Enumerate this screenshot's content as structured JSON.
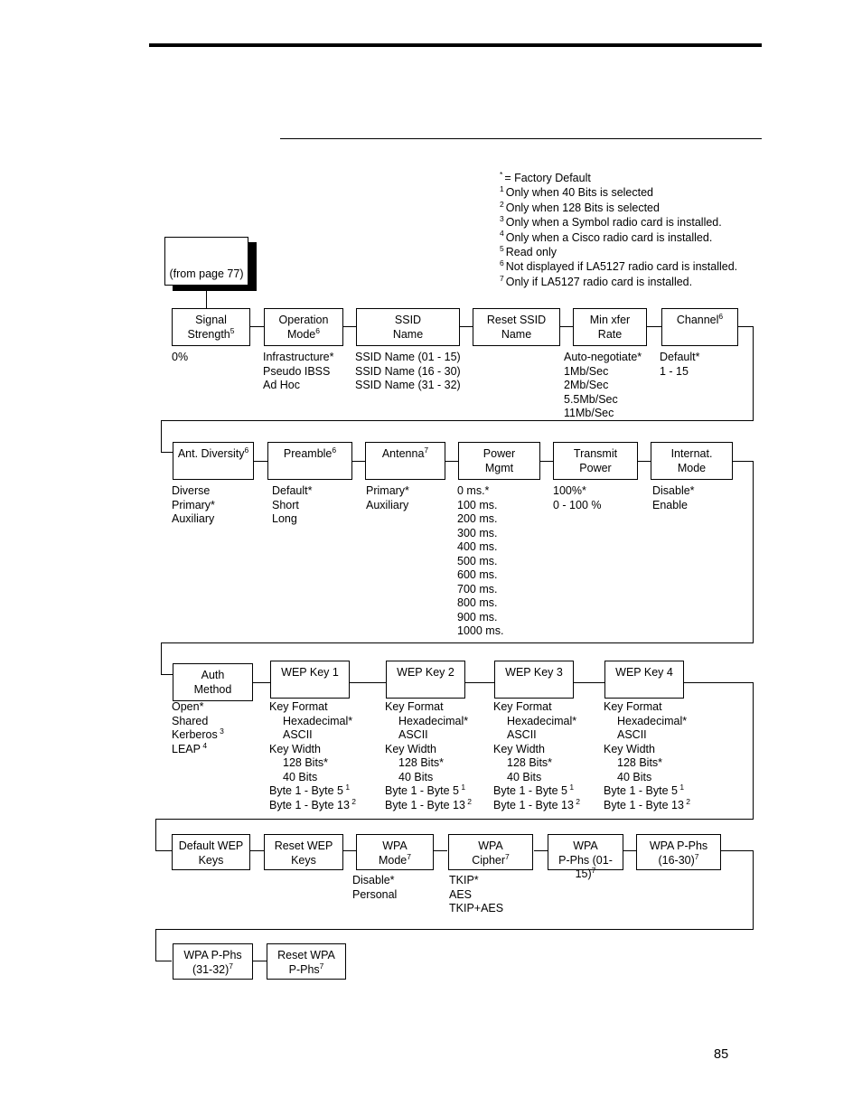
{
  "page": {
    "number": "85"
  },
  "legend": {
    "lines": [
      {
        "marker": "*",
        "text": "= Factory Default"
      },
      {
        "marker": "1",
        "text": "Only when 40 Bits is selected"
      },
      {
        "marker": "2",
        "text": "Only when 128 Bits is selected"
      },
      {
        "marker": "3",
        "text": "Only when a Symbol radio card is installed."
      },
      {
        "marker": "4",
        "text": "Only when a Cisco radio card is installed."
      },
      {
        "marker": "5",
        "text": "Read only"
      },
      {
        "marker": "6",
        "text": "Not displayed if LA5127 radio card is installed."
      },
      {
        "marker": "7",
        "text": "Only if LA5127 radio card is installed."
      }
    ]
  },
  "from_page_box": {
    "label": "(from page 77)"
  },
  "boxes": {
    "signal_strength": {
      "line1": "Signal",
      "line2": "Strength",
      "sup": "5"
    },
    "operation_mode": {
      "line1": "Operation",
      "line2": "Mode",
      "sup": "6"
    },
    "ssid_name": {
      "line1": "SSID",
      "line2": "Name",
      "sup": ""
    },
    "reset_ssid_name": {
      "line1": "Reset SSID",
      "line2": "Name",
      "sup": ""
    },
    "min_xfer_rate": {
      "line1": "Min xfer",
      "line2": "Rate",
      "sup": ""
    },
    "channel": {
      "line1": "Channel",
      "line2": "",
      "sup": "6"
    },
    "ant_diversity": {
      "line1": "Ant. Diversity",
      "line2": "",
      "sup": "6"
    },
    "preamble": {
      "line1": "Preamble",
      "line2": "",
      "sup": "6"
    },
    "antenna": {
      "line1": "Antenna",
      "line2": "",
      "sup": "7"
    },
    "power_mgmt": {
      "line1": "Power",
      "line2": "Mgmt",
      "sup": ""
    },
    "transmit_power": {
      "line1": "Transmit",
      "line2": "Power",
      "sup": ""
    },
    "internat_mode": {
      "line1": "Internat.",
      "line2": "Mode",
      "sup": ""
    },
    "auth_method": {
      "line1": "Auth",
      "line2": "Method",
      "sup": ""
    },
    "wep_key_1": {
      "line1": "WEP Key 1",
      "line2": "",
      "sup": ""
    },
    "wep_key_2": {
      "line1": "WEP Key 2",
      "line2": "",
      "sup": ""
    },
    "wep_key_3": {
      "line1": "WEP Key 3",
      "line2": "",
      "sup": ""
    },
    "wep_key_4": {
      "line1": "WEP Key 4",
      "line2": "",
      "sup": ""
    },
    "default_wep_keys": {
      "line1": "Default WEP",
      "line2": "Keys",
      "sup": ""
    },
    "reset_wep_keys": {
      "line1": "Reset WEP",
      "line2": "Keys",
      "sup": ""
    },
    "wpa_mode": {
      "line1": "WPA",
      "line2": "Mode",
      "sup": "7"
    },
    "wpa_cipher": {
      "line1": "WPA",
      "line2": "Cipher",
      "sup": "7"
    },
    "wpa_pphs_01_15": {
      "line1": "WPA",
      "line2": "P-Phs (01-15)",
      "sup": "7"
    },
    "wpa_pphs_16_30": {
      "line1": "WPA P-Phs",
      "line2": "(16-30)",
      "sup": "7"
    },
    "wpa_pphs_31_32": {
      "line1": "WPA P-Phs",
      "line2": "(31-32)",
      "sup": "7"
    },
    "reset_wpa_pphs": {
      "line1": "Reset WPA",
      "line2": "P-Phs",
      "sup": "7"
    }
  },
  "options": {
    "signal_strength": [
      {
        "text": "0%",
        "indent": false,
        "sup": ""
      }
    ],
    "operation_mode": [
      {
        "text": "Infrastructure*",
        "indent": false,
        "sup": ""
      },
      {
        "text": "Pseudo IBSS",
        "indent": false,
        "sup": ""
      },
      {
        "text": "Ad Hoc",
        "indent": false,
        "sup": ""
      }
    ],
    "ssid_name": [
      {
        "text": "SSID Name (01 - 15)",
        "indent": false,
        "sup": ""
      },
      {
        "text": "SSID Name (16 - 30)",
        "indent": false,
        "sup": ""
      },
      {
        "text": "SSID Name (31 - 32)",
        "indent": false,
        "sup": ""
      }
    ],
    "min_xfer_rate": [
      {
        "text": "Auto-negotiate*",
        "indent": false,
        "sup": ""
      },
      {
        "text": "1Mb/Sec",
        "indent": false,
        "sup": ""
      },
      {
        "text": "2Mb/Sec",
        "indent": false,
        "sup": ""
      },
      {
        "text": "5.5Mb/Sec",
        "indent": false,
        "sup": ""
      },
      {
        "text": "11Mb/Sec",
        "indent": false,
        "sup": ""
      }
    ],
    "channel": [
      {
        "text": "Default*",
        "indent": false,
        "sup": ""
      },
      {
        "text": "1 - 15",
        "indent": false,
        "sup": ""
      }
    ],
    "ant_diversity": [
      {
        "text": "Diverse",
        "indent": false,
        "sup": ""
      },
      {
        "text": "Primary*",
        "indent": false,
        "sup": ""
      },
      {
        "text": "Auxiliary",
        "indent": false,
        "sup": ""
      }
    ],
    "preamble": [
      {
        "text": "Default*",
        "indent": false,
        "sup": ""
      },
      {
        "text": "Short",
        "indent": false,
        "sup": ""
      },
      {
        "text": "Long",
        "indent": false,
        "sup": ""
      }
    ],
    "antenna": [
      {
        "text": "Primary*",
        "indent": false,
        "sup": ""
      },
      {
        "text": "Auxiliary",
        "indent": false,
        "sup": ""
      }
    ],
    "power_mgmt": [
      {
        "text": "0 ms.*",
        "indent": false,
        "sup": ""
      },
      {
        "text": "100 ms.",
        "indent": false,
        "sup": ""
      },
      {
        "text": "200 ms.",
        "indent": false,
        "sup": ""
      },
      {
        "text": "300 ms.",
        "indent": false,
        "sup": ""
      },
      {
        "text": "400 ms.",
        "indent": false,
        "sup": ""
      },
      {
        "text": "500 ms.",
        "indent": false,
        "sup": ""
      },
      {
        "text": "600 ms.",
        "indent": false,
        "sup": ""
      },
      {
        "text": "700 ms.",
        "indent": false,
        "sup": ""
      },
      {
        "text": "800 ms.",
        "indent": false,
        "sup": ""
      },
      {
        "text": "900 ms.",
        "indent": false,
        "sup": ""
      },
      {
        "text": "1000 ms.",
        "indent": false,
        "sup": ""
      }
    ],
    "transmit_power": [
      {
        "text": "100%*",
        "indent": false,
        "sup": ""
      },
      {
        "text": "0 - 100 %",
        "indent": false,
        "sup": ""
      }
    ],
    "internat_mode": [
      {
        "text": "Disable*",
        "indent": false,
        "sup": ""
      },
      {
        "text": "Enable",
        "indent": false,
        "sup": ""
      }
    ],
    "auth_method": [
      {
        "text": "Open*",
        "indent": false,
        "sup": ""
      },
      {
        "text": "Shared",
        "indent": false,
        "sup": ""
      },
      {
        "text": "Kerberos",
        "indent": false,
        "sup": "3"
      },
      {
        "text": "LEAP",
        "indent": false,
        "sup": "4"
      }
    ],
    "wep_key": [
      {
        "text": "Key Format",
        "indent": false,
        "sup": ""
      },
      {
        "text": "Hexadecimal*",
        "indent": true,
        "sup": ""
      },
      {
        "text": "ASCII",
        "indent": true,
        "sup": ""
      },
      {
        "text": "Key Width",
        "indent": false,
        "sup": ""
      },
      {
        "text": "128 Bits*",
        "indent": true,
        "sup": ""
      },
      {
        "text": "40 Bits",
        "indent": true,
        "sup": ""
      },
      {
        "text": "Byte 1 - Byte 5",
        "indent": false,
        "sup": "1"
      },
      {
        "text": "Byte 1 - Byte 13",
        "indent": false,
        "sup": "2"
      }
    ],
    "wpa_mode": [
      {
        "text": "Disable*",
        "indent": false,
        "sup": ""
      },
      {
        "text": "Personal",
        "indent": false,
        "sup": ""
      }
    ],
    "wpa_cipher": [
      {
        "text": "TKIP*",
        "indent": false,
        "sup": ""
      },
      {
        "text": "AES",
        "indent": false,
        "sup": ""
      },
      {
        "text": "TKIP+AES",
        "indent": false,
        "sup": ""
      }
    ]
  }
}
